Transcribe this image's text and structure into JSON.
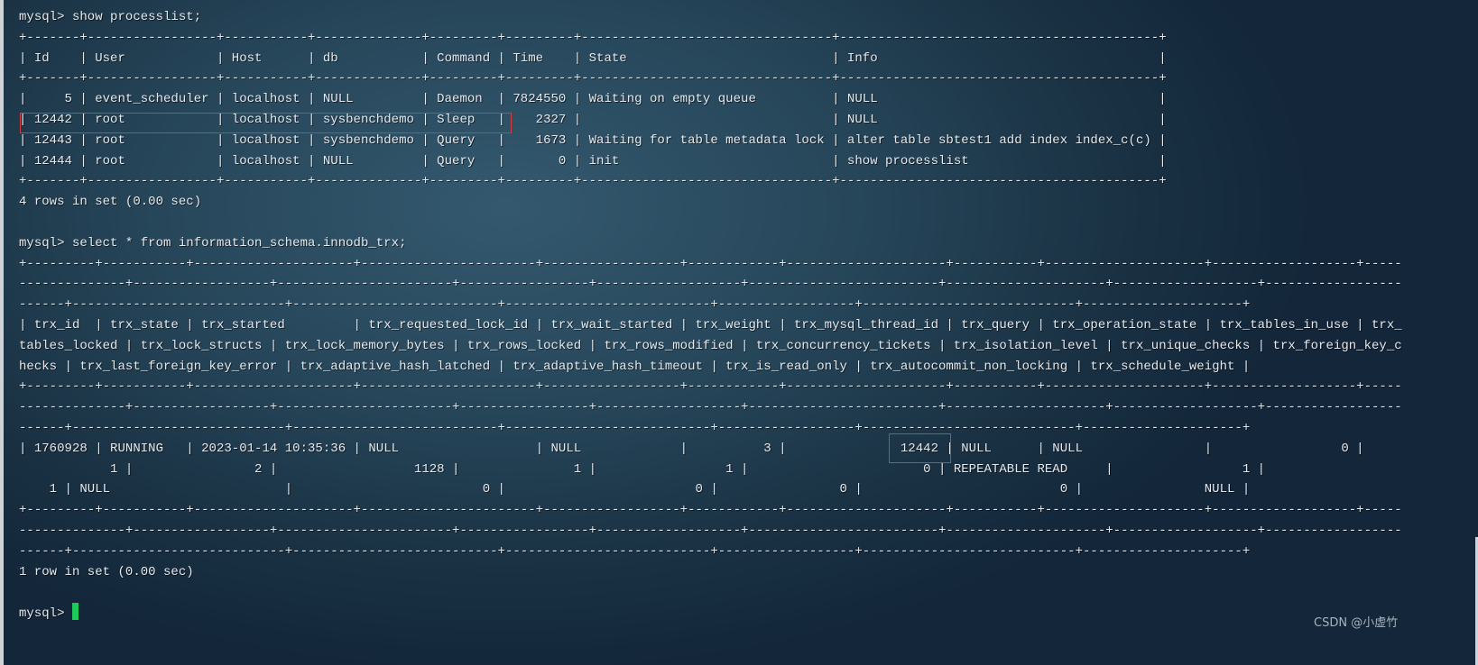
{
  "colors": {
    "background": "#264559",
    "text": "#e6e9ec",
    "highlight_box": "#d8393b",
    "cursor": "#1ec85a"
  },
  "session": [
    {
      "type": "command",
      "prompt": "mysql>",
      "text": "show processlist;"
    },
    {
      "type": "table",
      "name": "processlist-table",
      "columns": [
        {
          "name": "Id",
          "numeric": true
        },
        {
          "name": "User"
        },
        {
          "name": "Host"
        },
        {
          "name": "db"
        },
        {
          "name": "Command"
        },
        {
          "name": "Time",
          "numeric": true
        },
        {
          "name": "State"
        },
        {
          "name": "Info"
        }
      ],
      "rows": [
        [
          "5",
          "event_scheduler",
          "localhost",
          "NULL",
          "Daemon",
          "7824550",
          "Waiting on empty queue",
          "NULL"
        ],
        [
          "12442",
          "root",
          "localhost",
          "sysbenchdemo",
          "Sleep",
          "2327",
          "",
          "NULL"
        ],
        [
          "12443",
          "root",
          "localhost",
          "sysbenchdemo",
          "Query",
          "1673",
          "Waiting for table metadata lock",
          "alter table sbtest1 add index index_c(c)"
        ],
        [
          "12444",
          "root",
          "localhost",
          "NULL",
          "Query",
          "0",
          "init",
          "show processlist"
        ]
      ]
    },
    {
      "type": "text",
      "text": "4 rows in set (0.00 sec)"
    },
    {
      "type": "text",
      "text": ""
    },
    {
      "type": "command",
      "prompt": "mysql>",
      "text": "select * from information_schema.innodb_trx;"
    },
    {
      "type": "table",
      "name": "innodb-trx-table",
      "columns": [
        {
          "name": "trx_id",
          "numeric": true
        },
        {
          "name": "trx_state"
        },
        {
          "name": "trx_started"
        },
        {
          "name": "trx_requested_lock_id"
        },
        {
          "name": "trx_wait_started"
        },
        {
          "name": "trx_weight",
          "numeric": true
        },
        {
          "name": "trx_mysql_thread_id",
          "numeric": true
        },
        {
          "name": "trx_query"
        },
        {
          "name": "trx_operation_state"
        },
        {
          "name": "trx_tables_in_use",
          "numeric": true
        },
        {
          "name": "trx_tables_locked",
          "numeric": true
        },
        {
          "name": "trx_lock_structs",
          "numeric": true
        },
        {
          "name": "trx_lock_memory_bytes",
          "numeric": true
        },
        {
          "name": "trx_rows_locked",
          "numeric": true
        },
        {
          "name": "trx_rows_modified",
          "numeric": true
        },
        {
          "name": "trx_concurrency_tickets",
          "numeric": true
        },
        {
          "name": "trx_isolation_level"
        },
        {
          "name": "trx_unique_checks",
          "numeric": true
        },
        {
          "name": "trx_foreign_key_checks",
          "numeric": true
        },
        {
          "name": "trx_last_foreign_key_error"
        },
        {
          "name": "trx_adaptive_hash_latched",
          "numeric": true
        },
        {
          "name": "trx_adaptive_hash_timeout",
          "numeric": true
        },
        {
          "name": "trx_is_read_only",
          "numeric": true
        },
        {
          "name": "trx_autocommit_non_locking",
          "numeric": true
        },
        {
          "name": "trx_schedule_weight",
          "numeric": true
        }
      ],
      "rows": [
        [
          "1760928",
          "RUNNING",
          "2023-01-14 10:35:36",
          "NULL",
          "NULL",
          "3",
          "12442",
          "NULL",
          "NULL",
          "0",
          "1",
          "2",
          "1128",
          "1",
          "1",
          "0",
          "REPEATABLE READ",
          "1",
          "1",
          "NULL",
          "0",
          "0",
          "0",
          "0",
          "NULL"
        ]
      ]
    },
    {
      "type": "text",
      "text": "1 row in set (0.00 sec)"
    },
    {
      "type": "text",
      "text": ""
    },
    {
      "type": "prompt",
      "prompt": "mysql>",
      "text": ""
    }
  ],
  "highlights": [
    {
      "target": "processlist row 12442"
    },
    {
      "target": "trx_mysql_thread_id 12442"
    }
  ],
  "watermark": "CSDN @小虚竹"
}
